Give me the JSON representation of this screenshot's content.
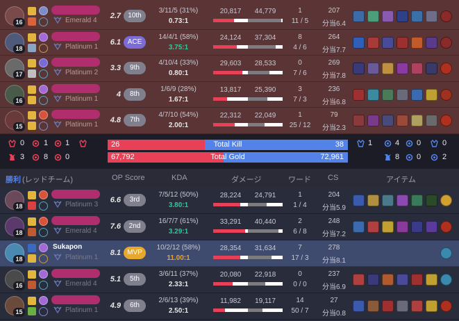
{
  "colors": {
    "loss_bg": "#5b3536",
    "win_bg": "#282c3b",
    "accent_red": "#e84057",
    "accent_blue": "#5383e8",
    "kda_good": "#35c59a",
    "mvp": "#e7a92d",
    "ace": "#7b6cd8"
  },
  "lose_team": {
    "players": [
      {
        "level": "16",
        "name": "",
        "tier": "Emerald 4",
        "op_score": "2.7",
        "badge": "10th",
        "kda_line": "3/11/5 (31%)",
        "kda_ratio": "0.73:1",
        "damage_dealt": "20,817",
        "damage_taken": "44,779",
        "dealt_ratio": 0.6,
        "taken_ratio": 0.95,
        "wards_placed": "1",
        "wards_detail": "11 / 5",
        "cs": "207",
        "cs_per_min": "分当6.4",
        "champ_color": "#7a4a4a",
        "spell_colors": [
          "#e2b53e",
          "#d9633a"
        ],
        "rune_colors": [
          "#7c8cc8",
          "#5ba7b9"
        ],
        "item_colors": [
          "#3d6ba8",
          "#4a9e7a",
          "#8a5ab0",
          "#2f3f88",
          "#3a6fa8",
          "#6e6e8a",
          "#8a2a2a"
        ]
      },
      {
        "level": "18",
        "name": "",
        "tier": "Platinum 1",
        "op_score": "6.1",
        "badge": "ACE",
        "kda_line": "14/4/1 (58%)",
        "kda_ratio": "3.75:1",
        "damage_dealt": "24,124",
        "damage_taken": "37,304",
        "dealt_ratio": 0.68,
        "taken_ratio": 0.8,
        "wards_placed": "8",
        "wards_detail": "4 / 6",
        "cs": "264",
        "cs_per_min": "分当7.7",
        "champ_color": "#4f5a7a",
        "spell_colors": [
          "#e2b53e",
          "#8aa4c4"
        ],
        "rune_colors": [
          "#a26ad6",
          "#c89a4a"
        ],
        "item_colors": [
          "#2f5fb8",
          "#a83a3a",
          "#4a4a9a",
          "#9a3030",
          "#c25a2a",
          "#5a3a8a",
          "#8a2a2a"
        ]
      },
      {
        "level": "17",
        "name": "",
        "tier": "Platinum 2",
        "op_score": "3.3",
        "badge": "9th",
        "kda_line": "4/10/4 (33%)",
        "kda_ratio": "0.80:1",
        "damage_dealt": "29,603",
        "damage_taken": "28,533",
        "dealt_ratio": 0.83,
        "taken_ratio": 0.62,
        "wards_placed": "0",
        "wards_detail": "7 / 6",
        "cs": "269",
        "cs_per_min": "分当7.8",
        "champ_color": "#6a6a6a",
        "spell_colors": [
          "#e2b53e",
          "#c0c0c0"
        ],
        "rune_colors": [
          "#7a6ad6",
          "#5ba7b9"
        ],
        "item_colors": [
          "#3a3a7a",
          "#6a5a9a",
          "#c09040",
          "#8a3aa0",
          "#b04060",
          "#3a3a6a",
          "#b03020"
        ]
      },
      {
        "level": "16",
        "name": "",
        "tier": "Platinum 1",
        "op_score": "4",
        "badge": "8th",
        "kda_line": "1/6/9 (28%)",
        "kda_ratio": "1.67:1",
        "damage_dealt": "13,817",
        "damage_taken": "25,390",
        "dealt_ratio": 0.4,
        "taken_ratio": 0.55,
        "wards_placed": "3",
        "wards_detail": "7 / 3",
        "cs": "236",
        "cs_per_min": "分当6.8",
        "champ_color": "#4a5a4a",
        "spell_colors": [
          "#e2b53e",
          "#e2b53e"
        ],
        "rune_colors": [
          "#a26ad6",
          "#5ba7b9"
        ],
        "item_colors": [
          "#a03030",
          "#3a8aa0",
          "#4a7a5a",
          "#6a6a7a",
          "#3a6ab0",
          "#c0a030",
          "#a03020"
        ]
      },
      {
        "level": "15",
        "name": "",
        "tier": "Platinum 1",
        "op_score": "4.8",
        "badge": "7th",
        "kda_line": "4/7/10 (54%)",
        "kda_ratio": "2.00:1",
        "damage_dealt": "22,312",
        "damage_taken": "22,049",
        "dealt_ratio": 0.62,
        "taken_ratio": 0.48,
        "wards_placed": "1",
        "wards_detail": "25 / 12",
        "cs": "79",
        "cs_per_min": "分当2.3",
        "champ_color": "#6a3a3a",
        "spell_colors": [
          "#e2b53e",
          "#e2b53e"
        ],
        "rune_colors": [
          "#d9533a",
          "#7c8cc8"
        ],
        "item_colors": [
          "#8a3a3a",
          "#7a3a8a",
          "#4a4a7a",
          "#9a4a3a",
          "#b0a060",
          "#6a6a6a",
          "#b03020"
        ]
      }
    ]
  },
  "summary": {
    "left_objectives": {
      "row1": [
        "0",
        "1",
        "1"
      ],
      "row2": [
        "3",
        "8",
        "0"
      ]
    },
    "right_objectives": {
      "row1": [
        "1",
        "4",
        "0"
      ],
      "row2": [
        "0",
        "8",
        "2"
      ]
    },
    "kill_left": "26",
    "kill_label": "Total Kill",
    "kill_right": "38",
    "kill_share_left": 0.406,
    "gold_left": "67,792",
    "gold_label": "Total Gold",
    "gold_right": "72,961",
    "gold_share_left": 0.482
  },
  "win_team": {
    "header": {
      "result": "勝利",
      "team": "(レッドチーム)",
      "op_score": "OP Score",
      "kda": "KDA",
      "damage": "ダメージ",
      "ward": "ワード",
      "cs": "CS",
      "items": "アイテム"
    },
    "players": [
      {
        "level": "18",
        "name": "",
        "tier": "Platinum 3",
        "op_score": "6.6",
        "badge": "3rd",
        "kda_line": "7/5/12 (50%)",
        "kda_ratio": "3.80:1",
        "damage_dealt": "28,224",
        "damage_taken": "24,791",
        "dealt_ratio": 0.78,
        "taken_ratio": 0.54,
        "wards_placed": "1",
        "wards_detail": "1 / 4",
        "cs": "204",
        "cs_per_min": "分当5.9",
        "champ_color": "#6a4a5a",
        "spell_colors": [
          "#e2b53e",
          "#d94040"
        ],
        "rune_colors": [
          "#d9533a",
          "#5ba7b9"
        ],
        "item_colors": [
          "#3a5ab0",
          "#b09040",
          "#4a7a8a",
          "#8a4ab0",
          "#3a7a5a",
          "#2a4a2a",
          "#d0a030"
        ]
      },
      {
        "level": "18",
        "name": "",
        "tier": "Emerald 4",
        "op_score": "7.6",
        "badge": "2nd",
        "kda_line": "16/7/7 (61%)",
        "kda_ratio": "3.29:1",
        "damage_dealt": "33,291",
        "damage_taken": "40,440",
        "dealt_ratio": 0.92,
        "taken_ratio": 0.88,
        "wards_placed": "2",
        "wards_detail": "6 / 8",
        "cs": "248",
        "cs_per_min": "分当7.2",
        "champ_color": "#5a3a6a",
        "spell_colors": [
          "#e2b53e",
          "#c05a30"
        ],
        "rune_colors": [
          "#d9533a",
          "#5ba7b9"
        ],
        "item_colors": [
          "#3a6ab0",
          "#b04040",
          "#c0a030",
          "#8a3a9a",
          "#3a3a8a",
          "#5a3a9a",
          "#b03020"
        ]
      },
      {
        "level": "18",
        "name": "Sukapon",
        "tier": "Platinum 1",
        "op_score": "8.1",
        "badge": "MVP",
        "kda_line": "10/2/12 (58%)",
        "kda_ratio": "11.00:1",
        "damage_dealt": "28,354",
        "damage_taken": "31,634",
        "dealt_ratio": 0.78,
        "taken_ratio": 0.68,
        "wards_placed": "7",
        "wards_detail": "17 / 3",
        "cs": "278",
        "cs_per_min": "分当8.1",
        "champ_color": "#4a8ab0",
        "spell_colors": [
          "#3a6ac0",
          "#e2b53e"
        ],
        "rune_colors": [
          "#a26ad6",
          "#c89a4a"
        ],
        "item_colors": [],
        "trinket_color": "#3a8ab0"
      },
      {
        "level": "16",
        "name": "",
        "tier": "Emerald 4",
        "op_score": "5.1",
        "badge": "5th",
        "kda_line": "3/6/11 (37%)",
        "kda_ratio": "2.33:1",
        "damage_dealt": "20,080",
        "damage_taken": "22,918",
        "dealt_ratio": 0.56,
        "taken_ratio": 0.5,
        "wards_placed": "0",
        "wards_detail": "0 / 0",
        "cs": "237",
        "cs_per_min": "分当6.9",
        "champ_color": "#4a4a4a",
        "spell_colors": [
          "#e2b53e",
          "#c05a30"
        ],
        "rune_colors": [
          "#a26ad6",
          "#5ba7b9"
        ],
        "item_colors": [
          "#b04040",
          "#3a3a7a",
          "#b05a30",
          "#4a4a9a",
          "#a03030",
          "#c0a030",
          "#3a8ab0"
        ]
      },
      {
        "level": "15",
        "name": "",
        "tier": "Platinum 1",
        "op_score": "4.9",
        "badge": "6th",
        "kda_line": "2/6/13 (39%)",
        "kda_ratio": "2.50:1",
        "damage_dealt": "11,982",
        "damage_taken": "19,117",
        "dealt_ratio": 0.34,
        "taken_ratio": 0.42,
        "wards_placed": "14",
        "wards_detail": "50 / 7",
        "cs": "27",
        "cs_per_min": "分当0.8",
        "champ_color": "#6a4a3a",
        "spell_colors": [
          "#e2b53e",
          "#6ab040"
        ],
        "rune_colors": [
          "#a26ad6",
          "#7c8cc8"
        ],
        "item_colors": [
          "#3a5ab0",
          "#8a5a3a",
          "#a03030",
          "#6a6a7a",
          "#b04040",
          "#c0a030",
          "#b03020"
        ]
      }
    ]
  }
}
